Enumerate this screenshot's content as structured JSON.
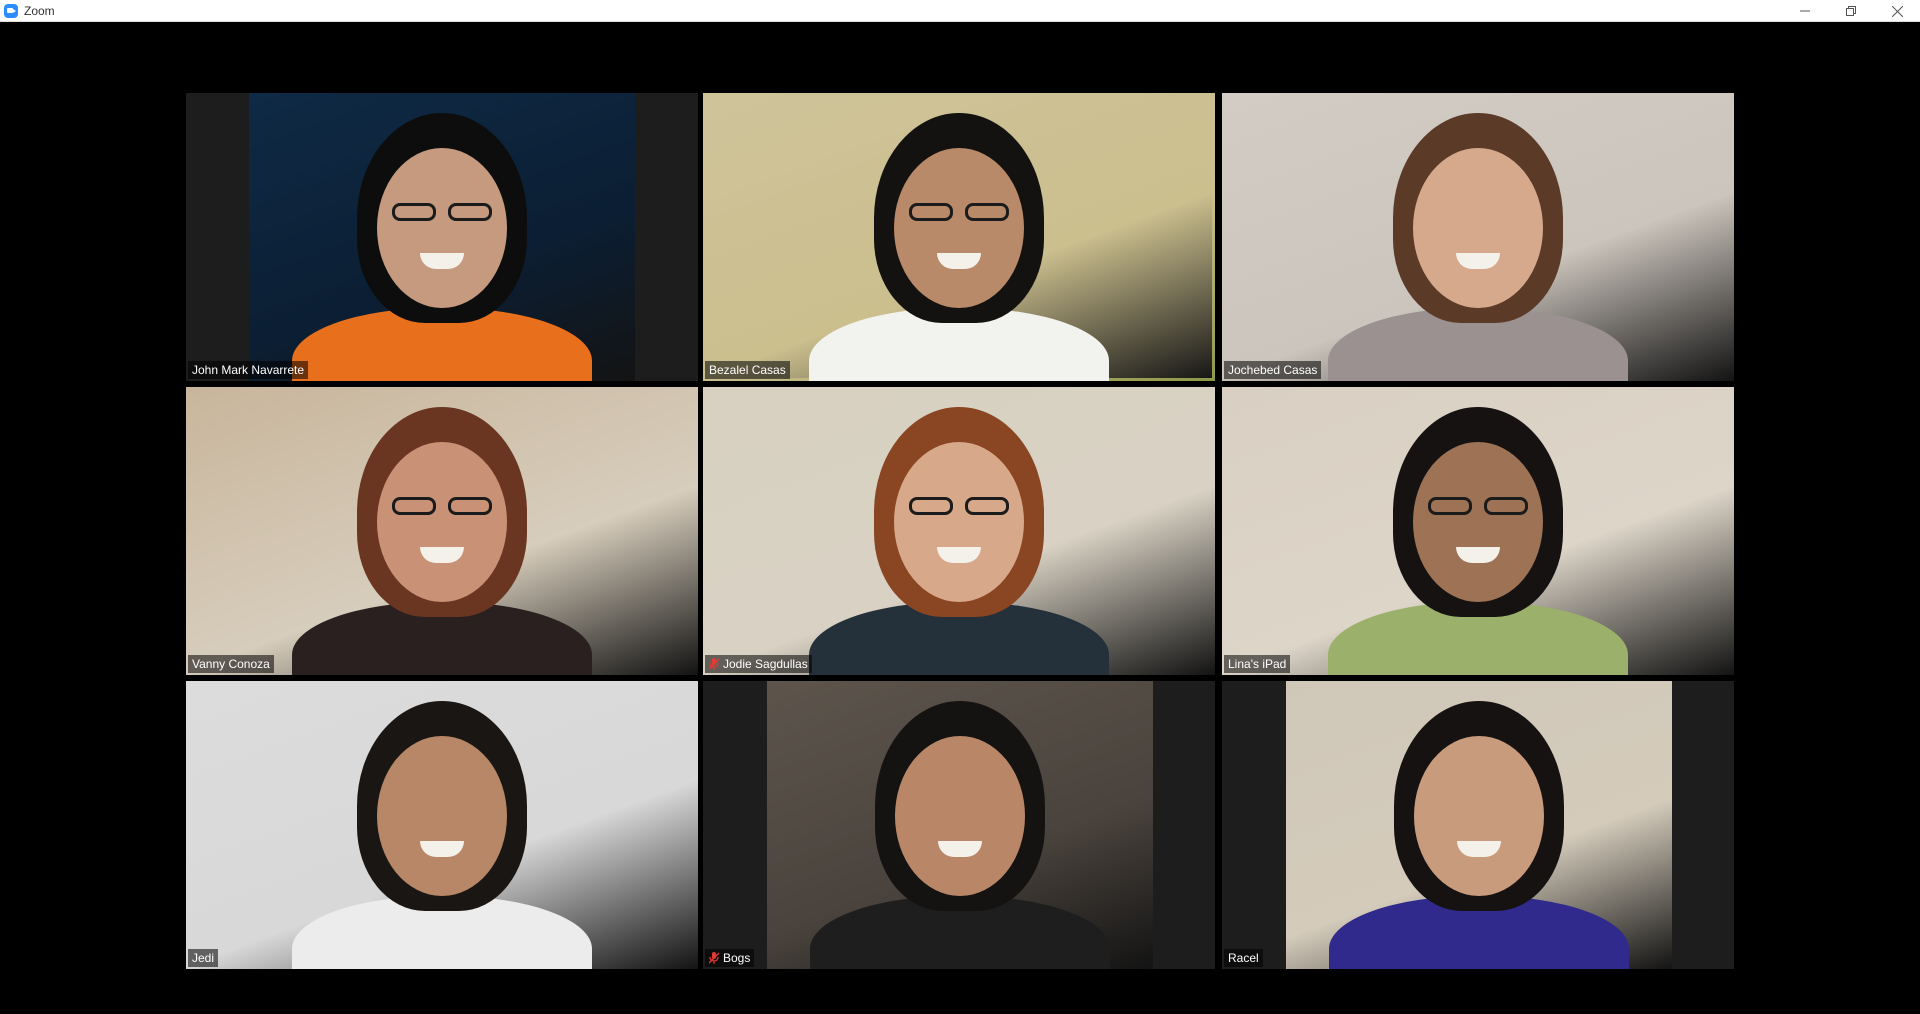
{
  "window": {
    "title": "Zoom",
    "controls": [
      "minimize",
      "restore",
      "close"
    ]
  },
  "participants": [
    {
      "name": "John Mark Navarrete",
      "muted": false,
      "active_speaker": false,
      "bg": "#0f2a45",
      "video_bg": "#0b1e33",
      "shirt": "#e8701c",
      "skin": "#c59a7f",
      "hair": "#0d0d0d",
      "glasses": true
    },
    {
      "name": "Bezalel Casas",
      "muted": false,
      "active_speaker": true,
      "bg": "#cfc39a",
      "video_bg": "#cbbf8e",
      "shirt": "#f2f2ee",
      "skin": "#b98a69",
      "hair": "#141210",
      "glasses": true
    },
    {
      "name": "Jochebed Casas",
      "muted": false,
      "active_speaker": false,
      "bg": "#d2ccc4",
      "video_bg": "#ccc5bd",
      "shirt": "#9a9190",
      "skin": "#d6a98c",
      "hair": "#5b3a28",
      "glasses": false
    },
    {
      "name": "Vanny Conoza",
      "muted": false,
      "active_speaker": false,
      "bg": "#c8b59b",
      "video_bg": "#d7cdbc",
      "shirt": "#2a2020",
      "skin": "#c99176",
      "hair": "#6a3622",
      "glasses": true
    },
    {
      "name": "Jodie Sagdullas",
      "muted": true,
      "active_speaker": false,
      "bg": "#d8d1c2",
      "video_bg": "#d9d2c4",
      "shirt": "#24303a",
      "skin": "#d7a889",
      "hair": "#8a4522",
      "glasses": true
    },
    {
      "name": "Lina's iPad",
      "muted": false,
      "active_speaker": false,
      "bg": "#d9d0c3",
      "video_bg": "#ddd5c8",
      "shirt": "#9bb06a",
      "skin": "#9e7355",
      "hair": "#161212",
      "glasses": true
    },
    {
      "name": "Jedi",
      "muted": false,
      "active_speaker": false,
      "bg": "#dcdcdc",
      "video_bg": "#d8d8d8",
      "shirt": "#ececec",
      "skin": "#b78767",
      "hair": "#1a1614",
      "glasses": false
    },
    {
      "name": "Bogs",
      "muted": true,
      "active_speaker": false,
      "bg": "#5d554c",
      "video_bg": "#4a433d",
      "shirt": "#1e1e1e",
      "skin": "#b98768",
      "hair": "#151311",
      "glasses": false
    },
    {
      "name": "Racel",
      "muted": false,
      "active_speaker": false,
      "bg": "#cfc7b8",
      "video_bg": "#d4cbbb",
      "shirt": "#2f2a8c",
      "skin": "#c99b7d",
      "hair": "#161211",
      "glasses": false
    }
  ]
}
